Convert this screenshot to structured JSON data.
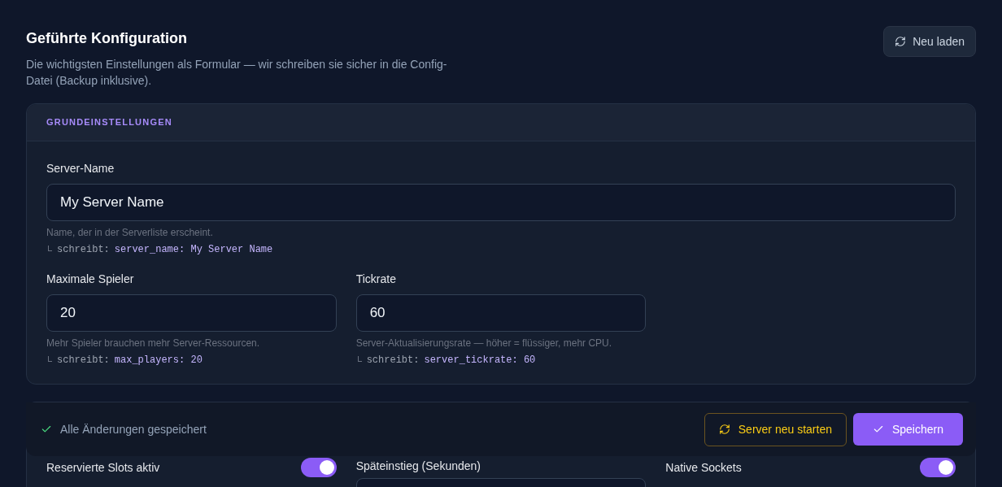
{
  "header": {
    "title": "Geführte Konfiguration",
    "subtitle": "Die wichtigsten Einstellungen als Formular — wir schreiben sie sicher in die Config-Datei (Backup inklusive).",
    "reload_button": "Neu laden"
  },
  "section": {
    "title": "GRUNDEINSTELLUNGEN",
    "fields": [
      {
        "label": "Server-Name",
        "value": "My Server Name",
        "help": "Name, der in der Serverliste erscheint.",
        "writes_prefix": "schreibt:",
        "writes": "server_name: My Server Name",
        "wide": true
      },
      {
        "label": "Maximale Spieler",
        "value": "20",
        "help": "Mehr Spieler brauchen mehr Server-Ressourcen.",
        "writes_prefix": "schreibt:",
        "writes": "max_players: 20",
        "wide": false
      },
      {
        "label": "Tickrate",
        "value": "60",
        "help": "Server-Aktualisierungsrate — höher = flüssiger, mehr CPU.",
        "writes_prefix": "schreibt:",
        "writes": "server_tickrate: 60",
        "wide": false
      }
    ]
  },
  "save_bar": {
    "status": "Alle Änderungen gespeichert",
    "restart_button": "Server neu starten",
    "save_button": "Speichern"
  },
  "next_section": {
    "items": [
      {
        "kind": "toggle",
        "label": "Reservierte Slots aktiv",
        "on": true
      },
      {
        "kind": "number",
        "label": "Späteinstieg (Sekunden)"
      },
      {
        "kind": "toggle",
        "label": "Native Sockets",
        "on": true
      }
    ]
  }
}
